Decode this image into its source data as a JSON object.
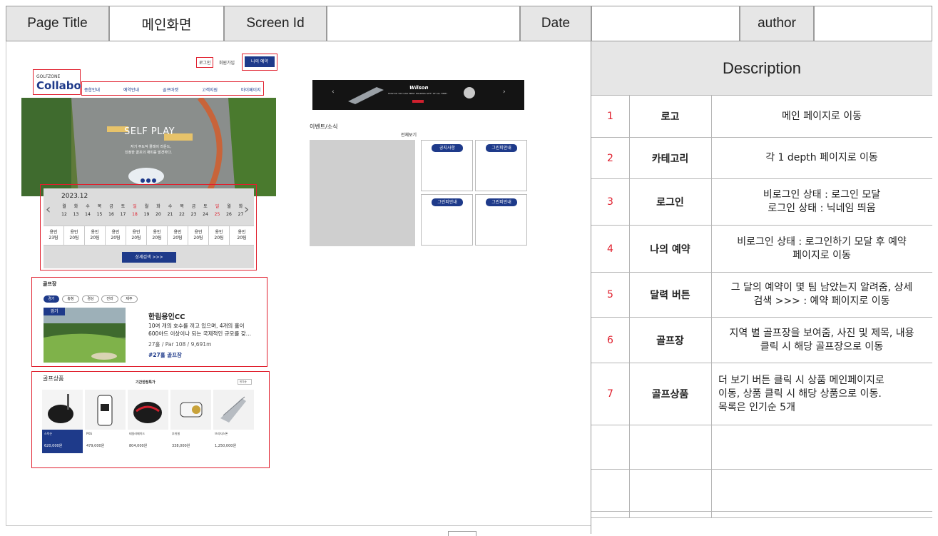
{
  "header": {
    "page_title_label": "Page Title",
    "page_title_value": "메인화면",
    "screen_id_label": "Screen Id",
    "screen_id_value": "",
    "date_label": "Date",
    "date_value": "",
    "author_label": "author",
    "author_value": ""
  },
  "mockup": {
    "top_links": {
      "login": "로그인",
      "signup": "회원가입",
      "my_reservation": "나의 예약"
    },
    "logo": {
      "small": "GOLFZONE",
      "big": "Collabo"
    },
    "nav": [
      "종합안내",
      "예약안내",
      "골프마켓",
      "고객지원",
      "마이페이지"
    ],
    "hero": {
      "title": "SELF PLAY",
      "line1": "자기 주도적 플레이 라운드,",
      "line2": "진정한 골프의 재미를 발견하다."
    },
    "calendar": {
      "month": "2023.12",
      "weekdays": [
        "월",
        "화",
        "수",
        "목",
        "금",
        "토",
        "일",
        "월",
        "화",
        "수",
        "목",
        "금",
        "토",
        "일",
        "월",
        "화"
      ],
      "dates": [
        "12",
        "13",
        "14",
        "15",
        "16",
        "17",
        "18",
        "19",
        "20",
        "21",
        "22",
        "23",
        "24",
        "25",
        "26",
        "27"
      ],
      "slots": [
        {
          "a": "용인",
          "b": "23팀"
        },
        {
          "a": "용인",
          "b": "20팀"
        },
        {
          "a": "용인",
          "b": "20팀"
        },
        {
          "a": "용인",
          "b": "20팀"
        },
        {
          "a": "용인",
          "b": "20팀"
        },
        {
          "a": "용인",
          "b": "20팀"
        },
        {
          "a": "용인",
          "b": "20팀"
        },
        {
          "a": "용인",
          "b": "20팀"
        },
        {
          "a": "용인",
          "b": "20팀"
        },
        {
          "a": "용인",
          "b": "20팀"
        }
      ],
      "search_button": "상세검색 >>>"
    },
    "golf": {
      "section_title": "골프장",
      "chips": [
        "경기",
        "충청",
        "경상",
        "전라",
        "제주"
      ],
      "badge": "경기",
      "name": "한림용인CC",
      "desc1": "10여 개의 호수를 끼고 있으며, 4개의 홀이",
      "desc2": "600야드 이상이나 되는 국제적인 규모를 갖…",
      "spec": "27홀 / Par 108 / 9,691m",
      "tag": "#27홀 골프장"
    },
    "products": {
      "section_title": "골프상품",
      "sub_title": "기간한정특가",
      "sort": "인기순",
      "items": [
        {
          "brand": "스릭슨",
          "price": "620,000원"
        },
        {
          "brand": "PXG",
          "price": "479,000원"
        },
        {
          "brand": "테일러메이드",
          "price": "804,000원"
        },
        {
          "brand": "부쉬넬",
          "price": "338,000원"
        },
        {
          "brand": "브리지스톤",
          "price": "1,250,000원"
        }
      ]
    },
    "banner": {
      "brand": "Wilson",
      "caption": "HOW DO YOU CAN \"BEST HOLDING GIFT\" OF ALL TIME?"
    },
    "event": {
      "title": "이벤트/소식",
      "more": "전체보기",
      "buttons": [
        "공지사항",
        "그린피안내",
        "그린피안내",
        "그린피안내"
      ]
    }
  },
  "description": {
    "title": "Description",
    "rows": [
      {
        "num": "1",
        "name": "로고",
        "text": "메인 페이지로 이동"
      },
      {
        "num": "2",
        "name": "카테고리",
        "text": "각 1 depth 페이지로 이동"
      },
      {
        "num": "3",
        "name": "로그인",
        "text": "비로그인 상태 : 로그인 모달\n로그인 상태 : 닉네임 띄움"
      },
      {
        "num": "4",
        "name": "나의 예약",
        "text": "비로그인 상태 : 로그인하기 모달 후 예약\n페이지로 이동"
      },
      {
        "num": "5",
        "name": "달력 버튼",
        "text": "그 달의 예약이 몇 팀 남았는지 알려줌, 상세\n검색 >>> : 예약 페이지로 이동"
      },
      {
        "num": "6",
        "name": "골프장",
        "text": "지역 별 골프장을 보여줌, 사진 및 제목, 내용\n클릭 시 해당 골프장으로 이동"
      },
      {
        "num": "7",
        "name": "골프상품",
        "text": "더 보기 버튼 클릭 시 상품 메인페이지로\n이동, 상품 클릭 시 해당 상품으로 이동.\n목록은 인기순 5개"
      }
    ]
  },
  "colors": {
    "accent_red": "#e0202e",
    "navy": "#1e3a8a",
    "header_gray": "#e6e6e6"
  }
}
